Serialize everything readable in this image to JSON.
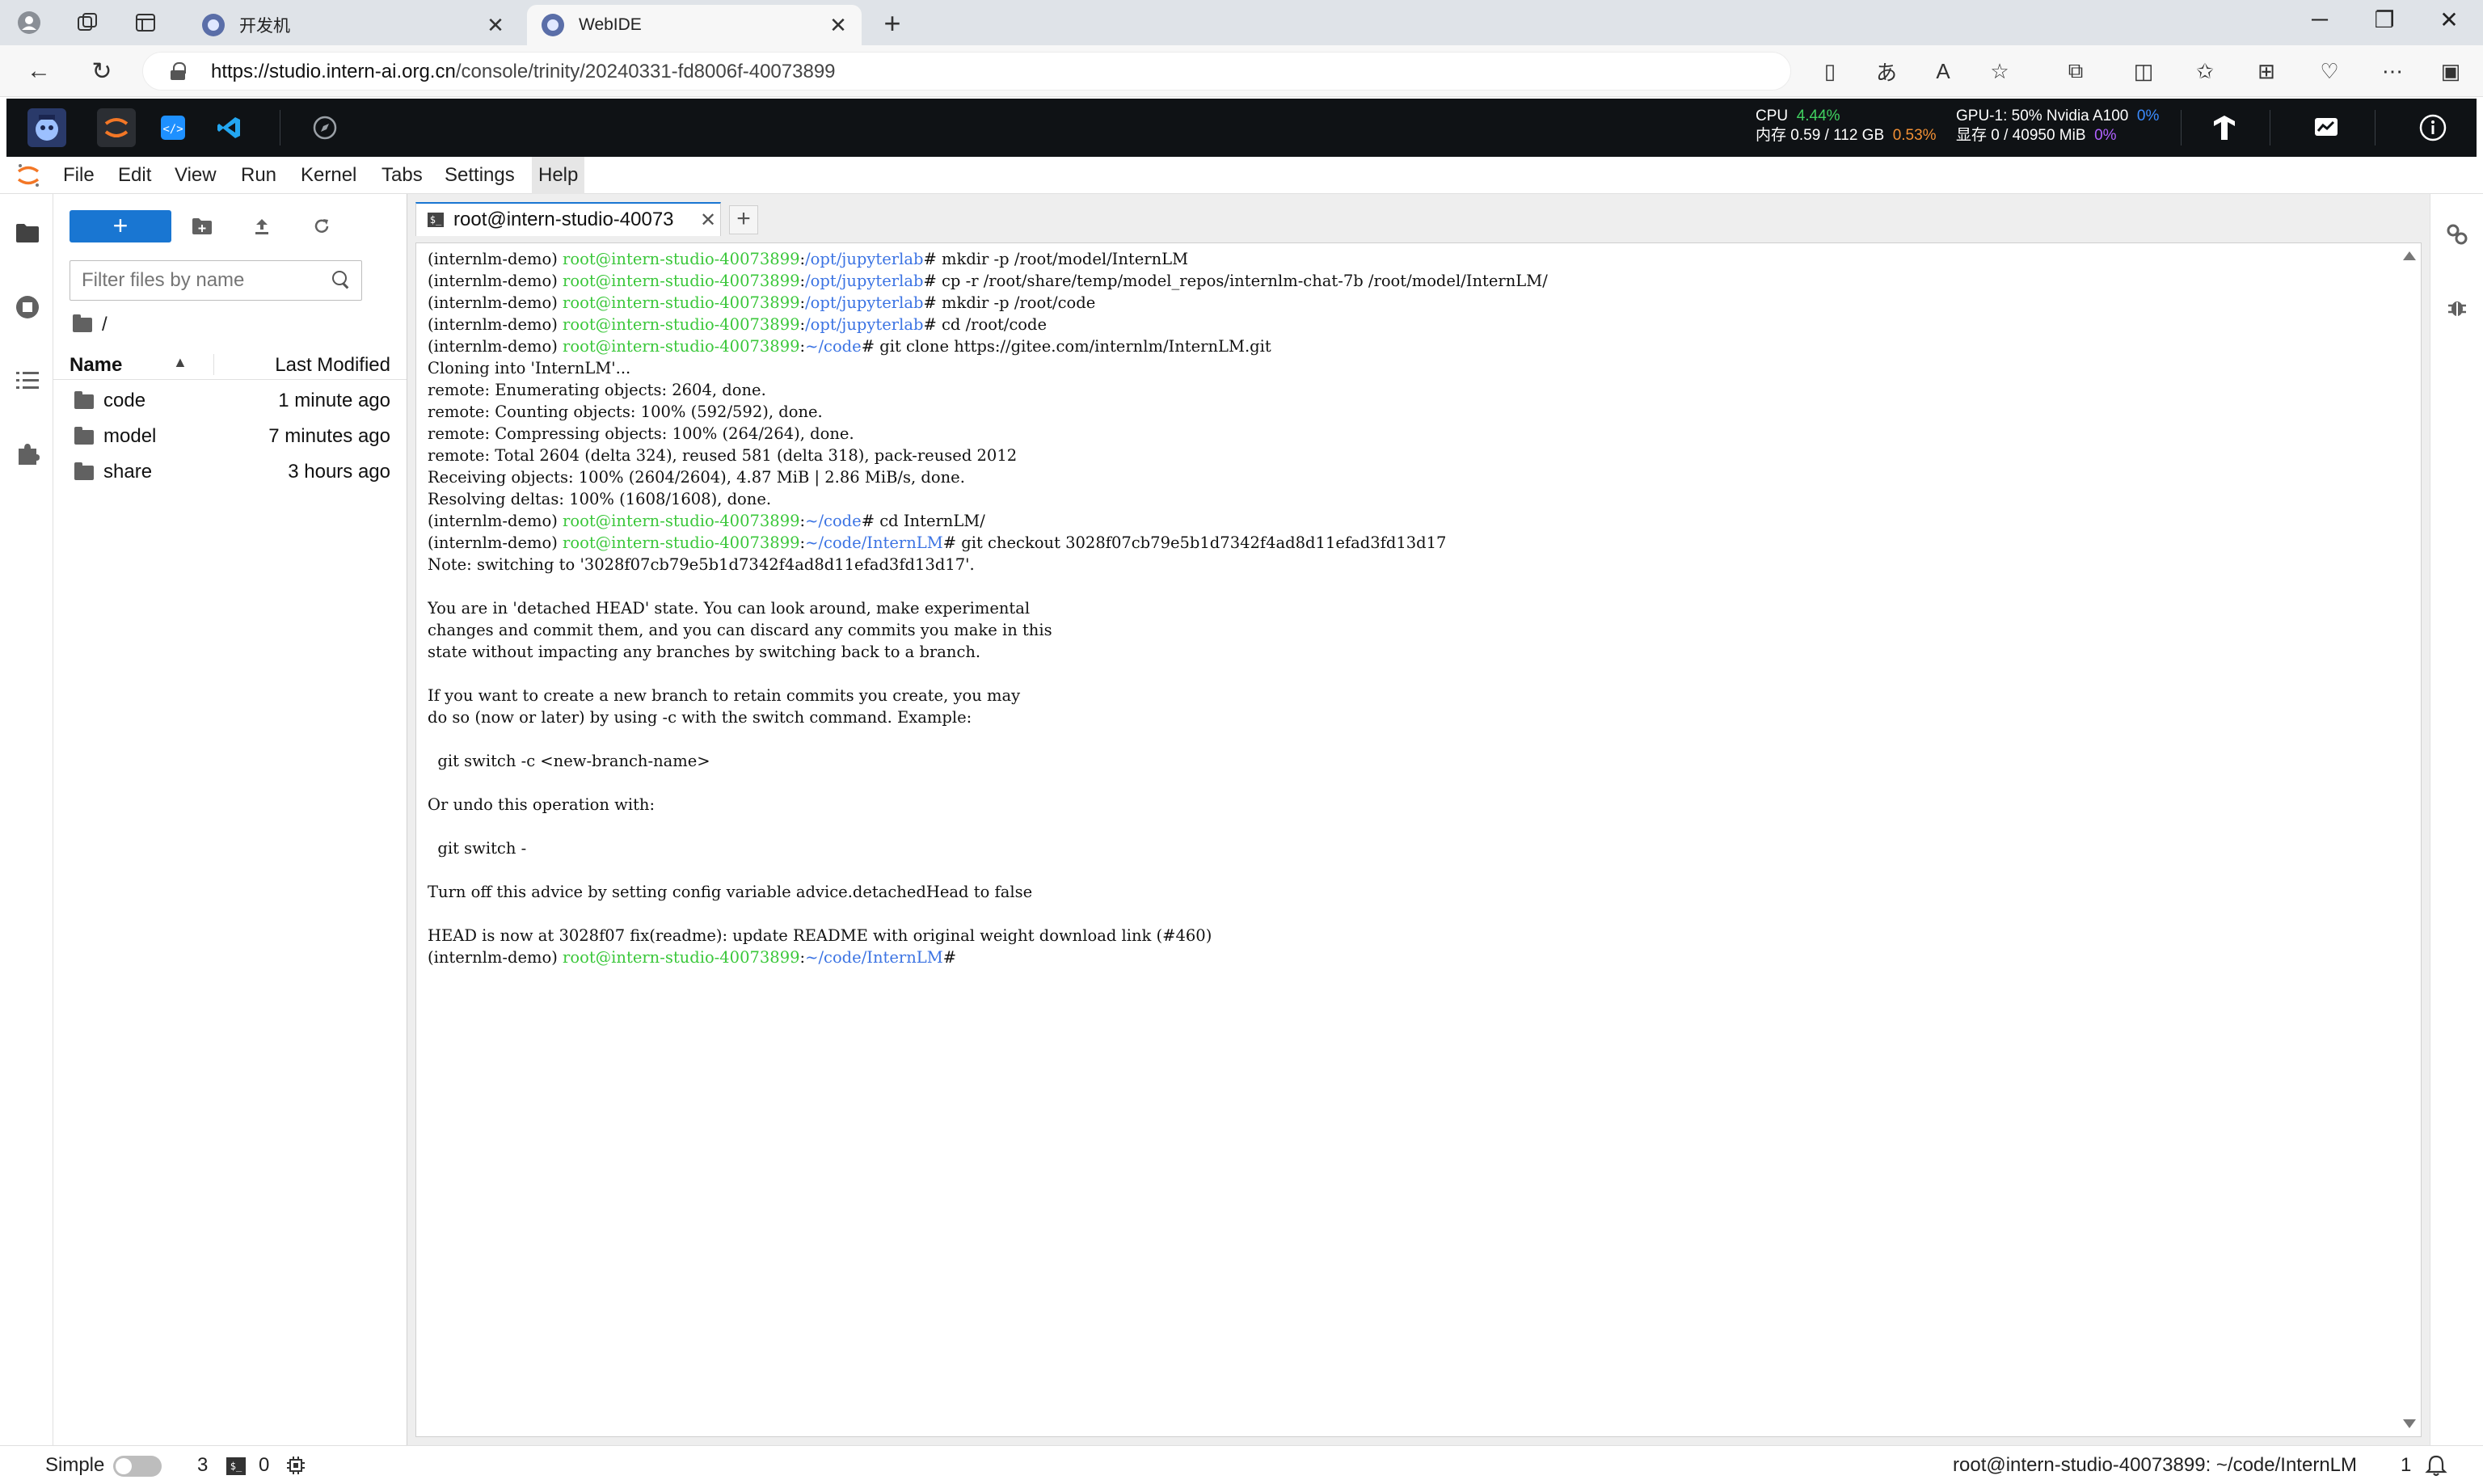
{
  "browser": {
    "tabs": [
      {
        "title": "开发机",
        "active": false
      },
      {
        "title": "WebIDE",
        "active": true
      }
    ],
    "url_host": "https://studio.intern-ai.org.cn",
    "url_path": "/console/trinity/20240331-fd8006f-40073899"
  },
  "resources": {
    "cpu_label": "CPU",
    "cpu_value": "4.44%",
    "mem_label": "内存 0.59 / 112 GB",
    "mem_value": "0.53%",
    "gpu_label": "GPU-1: 50% Nvidia A100",
    "gpu_value": "0%",
    "vram_label": "显存 0 / 40950 MiB",
    "vram_value": "0%"
  },
  "menu": {
    "items": [
      "File",
      "Edit",
      "View",
      "Run",
      "Kernel",
      "Tabs",
      "Settings",
      "Help"
    ],
    "open_item": "Help"
  },
  "filebrowser": {
    "new_label": "+",
    "filter_placeholder": "Filter files by name",
    "breadcrumb": "/",
    "col_name": "Name",
    "col_modified": "Last Modified",
    "items": [
      {
        "name": "code",
        "modified": "1 minute ago"
      },
      {
        "name": "model",
        "modified": "7 minutes ago"
      },
      {
        "name": "share",
        "modified": "3 hours ago"
      }
    ]
  },
  "terminal_tab": {
    "label": "root@intern-studio-40073"
  },
  "terminal": {
    "lines": [
      [
        {
          "t": "(internlm-demo) ",
          "c": ""
        },
        {
          "t": "root@intern-studio-40073899",
          "c": "u"
        },
        {
          "t": ":",
          "c": ""
        },
        {
          "t": "/opt/jupyterlab",
          "c": "d"
        },
        {
          "t": "# mkdir -p /root/model/InternLM",
          "c": ""
        }
      ],
      [
        {
          "t": "(internlm-demo) ",
          "c": ""
        },
        {
          "t": "root@intern-studio-40073899",
          "c": "u"
        },
        {
          "t": ":",
          "c": ""
        },
        {
          "t": "/opt/jupyterlab",
          "c": "d"
        },
        {
          "t": "# cp -r /root/share/temp/model_repos/internlm-chat-7b /root/model/InternLM/",
          "c": ""
        }
      ],
      [
        {
          "t": "(internlm-demo) ",
          "c": ""
        },
        {
          "t": "root@intern-studio-40073899",
          "c": "u"
        },
        {
          "t": ":",
          "c": ""
        },
        {
          "t": "/opt/jupyterlab",
          "c": "d"
        },
        {
          "t": "# mkdir -p /root/code",
          "c": ""
        }
      ],
      [
        {
          "t": "(internlm-demo) ",
          "c": ""
        },
        {
          "t": "root@intern-studio-40073899",
          "c": "u"
        },
        {
          "t": ":",
          "c": ""
        },
        {
          "t": "/opt/jupyterlab",
          "c": "d"
        },
        {
          "t": "# cd /root/code",
          "c": ""
        }
      ],
      [
        {
          "t": "(internlm-demo) ",
          "c": ""
        },
        {
          "t": "root@intern-studio-40073899",
          "c": "u"
        },
        {
          "t": ":",
          "c": ""
        },
        {
          "t": "~/code",
          "c": "d"
        },
        {
          "t": "# git clone https://gitee.com/internlm/InternLM.git",
          "c": ""
        }
      ],
      [
        {
          "t": "Cloning into 'InternLM'...",
          "c": ""
        }
      ],
      [
        {
          "t": "remote: Enumerating objects: 2604, done.",
          "c": ""
        }
      ],
      [
        {
          "t": "remote: Counting objects: 100% (592/592), done.",
          "c": ""
        }
      ],
      [
        {
          "t": "remote: Compressing objects: 100% (264/264), done.",
          "c": ""
        }
      ],
      [
        {
          "t": "remote: Total 2604 (delta 324), reused 581 (delta 318), pack-reused 2012",
          "c": ""
        }
      ],
      [
        {
          "t": "Receiving objects: 100% (2604/2604), 4.87 MiB | 2.86 MiB/s, done.",
          "c": ""
        }
      ],
      [
        {
          "t": "Resolving deltas: 100% (1608/1608), done.",
          "c": ""
        }
      ],
      [
        {
          "t": "(internlm-demo) ",
          "c": ""
        },
        {
          "t": "root@intern-studio-40073899",
          "c": "u"
        },
        {
          "t": ":",
          "c": ""
        },
        {
          "t": "~/code",
          "c": "d"
        },
        {
          "t": "# cd InternLM/",
          "c": ""
        }
      ],
      [
        {
          "t": "(internlm-demo) ",
          "c": ""
        },
        {
          "t": "root@intern-studio-40073899",
          "c": "u"
        },
        {
          "t": ":",
          "c": ""
        },
        {
          "t": "~/code/InternLM",
          "c": "d"
        },
        {
          "t": "# git checkout 3028f07cb79e5b1d7342f4ad8d11efad3fd13d17",
          "c": ""
        }
      ],
      [
        {
          "t": "Note: switching to '3028f07cb79e5b1d7342f4ad8d11efad3fd13d17'.",
          "c": ""
        }
      ],
      [
        {
          "t": "",
          "c": ""
        }
      ],
      [
        {
          "t": "You are in 'detached HEAD' state. You can look around, make experimental",
          "c": ""
        }
      ],
      [
        {
          "t": "changes and commit them, and you can discard any commits you make in this",
          "c": ""
        }
      ],
      [
        {
          "t": "state without impacting any branches by switching back to a branch.",
          "c": ""
        }
      ],
      [
        {
          "t": "",
          "c": ""
        }
      ],
      [
        {
          "t": "If you want to create a new branch to retain commits you create, you may",
          "c": ""
        }
      ],
      [
        {
          "t": "do so (now or later) by using -c with the switch command. Example:",
          "c": ""
        }
      ],
      [
        {
          "t": "",
          "c": ""
        }
      ],
      [
        {
          "t": "  git switch -c <new-branch-name>",
          "c": ""
        }
      ],
      [
        {
          "t": "",
          "c": ""
        }
      ],
      [
        {
          "t": "Or undo this operation with:",
          "c": ""
        }
      ],
      [
        {
          "t": "",
          "c": ""
        }
      ],
      [
        {
          "t": "  git switch -",
          "c": ""
        }
      ],
      [
        {
          "t": "",
          "c": ""
        }
      ],
      [
        {
          "t": "Turn off this advice by setting config variable advice.detachedHead to false",
          "c": ""
        }
      ],
      [
        {
          "t": "",
          "c": ""
        }
      ],
      [
        {
          "t": "HEAD is now at 3028f07 fix(readme): update README with original weight download link (#460)",
          "c": ""
        }
      ],
      [
        {
          "t": "(internlm-demo) ",
          "c": ""
        },
        {
          "t": "root@intern-studio-40073899",
          "c": "u"
        },
        {
          "t": ":",
          "c": ""
        },
        {
          "t": "~/code/InternLM",
          "c": "d"
        },
        {
          "t": "# ",
          "c": ""
        }
      ]
    ]
  },
  "statusbar": {
    "simple_label": "Simple",
    "kernels_count": "3",
    "terminals_count": "0",
    "path": "root@intern-studio-40073899: ~/code/InternLM",
    "notifications": "1"
  },
  "colors": {
    "prompt_user": "#3ac73a",
    "prompt_dir": "#3b73e3",
    "accent": "#1976d2",
    "appbar_bg": "#0f1215"
  }
}
